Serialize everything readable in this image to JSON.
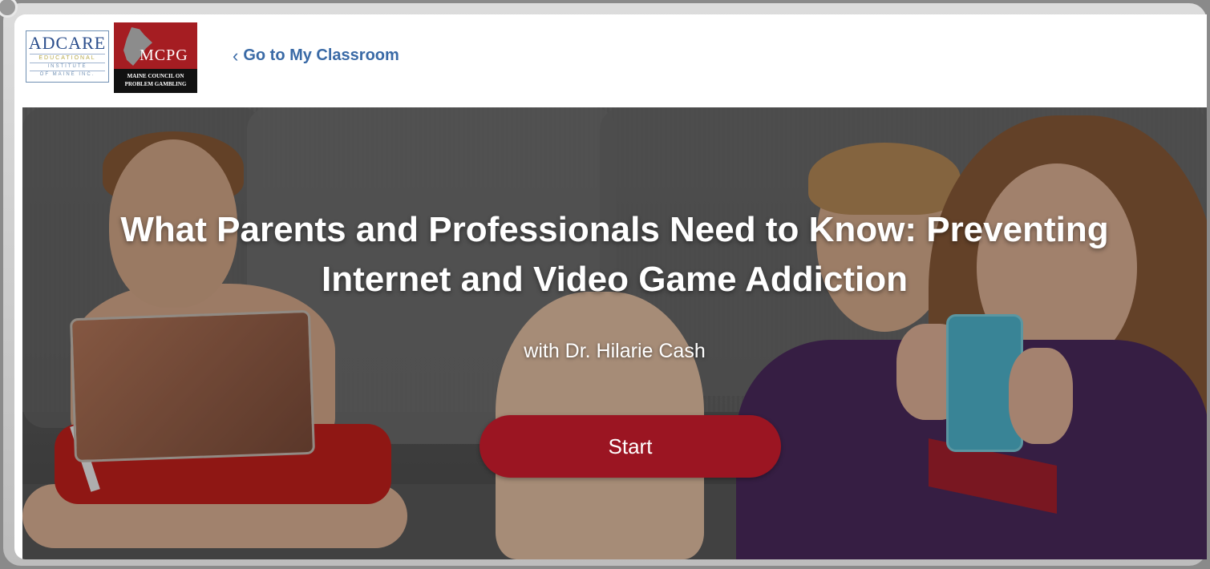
{
  "header": {
    "logo_adcare": {
      "brand": "ADCARE",
      "line1": "EDUCATIONAL",
      "line2": "INSTITUTE",
      "line3": "OF MAINE INC."
    },
    "logo_mcpg": {
      "mark": "MCPG",
      "band_line1": "MAINE COUNCIL ON",
      "band_line2": "PROBLEM GAMBLING"
    },
    "back_link_label": "Go to My Classroom",
    "back_icon": "chevron-left-icon"
  },
  "hero": {
    "title": "What Parents and Professionals Need to Know: Preventing Internet and Video Game Addiction",
    "subtitle": "with Dr. Hilarie Cash",
    "start_label": "Start"
  },
  "colors": {
    "link": "#3a6aa6",
    "button": "#9b1522",
    "mcpg_red": "#a51d22"
  }
}
